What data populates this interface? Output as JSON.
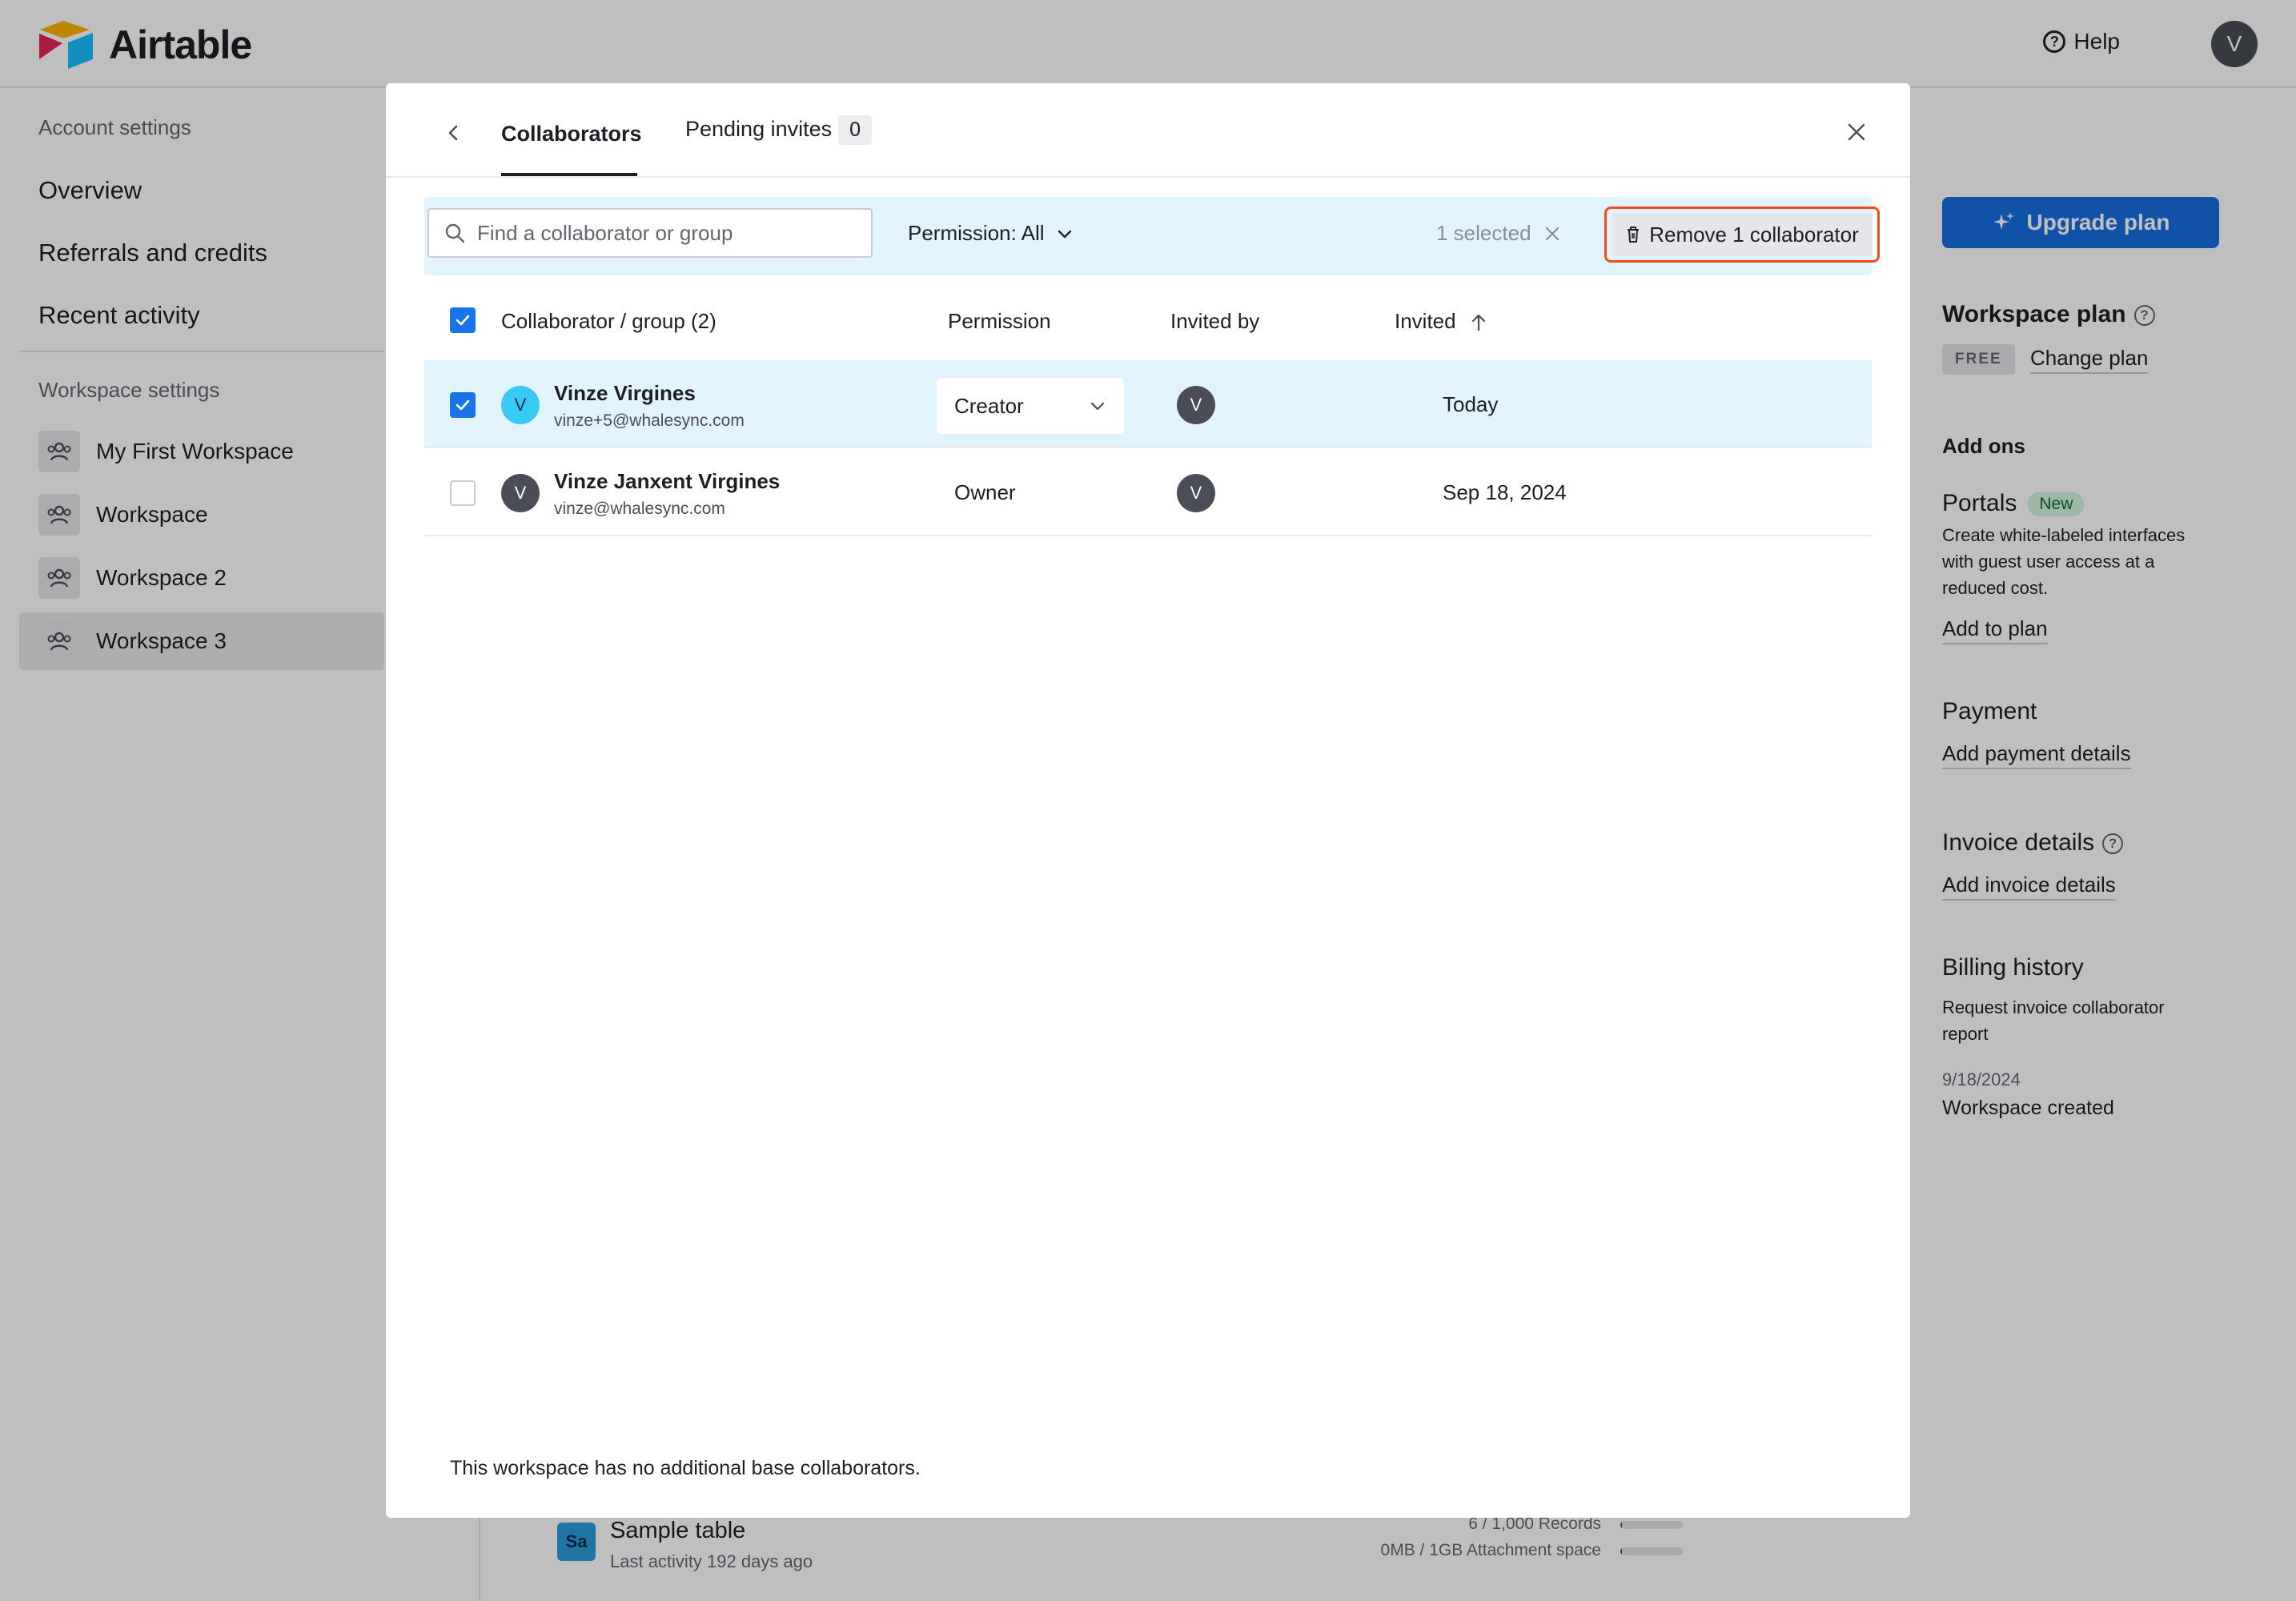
{
  "app": {
    "name": "Airtable",
    "help_label": "Help",
    "user_initial": "V"
  },
  "sidebar": {
    "account_heading": "Account settings",
    "account_items": [
      {
        "label": "Overview"
      },
      {
        "label": "Referrals and credits"
      },
      {
        "label": "Recent activity"
      }
    ],
    "workspace_heading": "Workspace settings",
    "workspaces": [
      {
        "label": "My First Workspace",
        "active": false
      },
      {
        "label": "Workspace",
        "active": false
      },
      {
        "label": "Workspace 2",
        "active": false
      },
      {
        "label": "Workspace 3",
        "active": true
      }
    ]
  },
  "right_panel": {
    "upgrade_label": "Upgrade plan",
    "plan_heading": "Workspace plan",
    "plan_badge": "FREE",
    "change_plan_label": "Change plan",
    "addons_heading": "Add ons",
    "portals_title": "Portals",
    "portals_badge": "New",
    "portals_desc_1": "Create white-labeled interfaces",
    "portals_desc_2": "with guest user access at a",
    "portals_desc_3": "reduced cost.",
    "add_to_plan_label": "Add to plan",
    "payment_heading": "Payment",
    "add_payment_label": "Add payment details",
    "invoice_heading": "Invoice details",
    "add_invoice_label": "Add invoice details",
    "billing_heading": "Billing history",
    "billing_request_1": "Request invoice collaborator",
    "billing_request_2": "report",
    "billing_date": "9/18/2024",
    "billing_event": "Workspace created"
  },
  "background_base": {
    "icon_label": "Sa",
    "title": "Sample table",
    "subtitle": "Last activity 192 days ago",
    "records_label": "6 / 1,000 Records",
    "records_fraction": 0.006,
    "attachments_label": "0MB / 1GB Attachment space",
    "attachments_fraction": 0.0
  },
  "modal": {
    "tabs": [
      {
        "label": "Collaborators",
        "active": true
      },
      {
        "label": "Pending invites",
        "count": "0",
        "active": false
      }
    ],
    "search_placeholder": "Find a collaborator or group",
    "permission_filter": "Permission: All",
    "selected_label": "1 selected",
    "remove_label": "Remove 1 collaborator",
    "columns": {
      "collaborator": "Collaborator / group (2)",
      "permission": "Permission",
      "invited_by": "Invited by",
      "invited": "Invited"
    },
    "rows": [
      {
        "initial": "V",
        "name": "Vinze Virgines",
        "email": "vinze+5@whalesync.com",
        "permission": "Creator",
        "invited_by_initial": "V",
        "invited": "Today",
        "selected": true
      },
      {
        "initial": "V",
        "name": "Vinze Janxent Virgines",
        "email": "vinze@whalesync.com",
        "permission": "Owner",
        "invited_by_initial": "V",
        "invited": "Sep 18, 2024",
        "selected": false
      }
    ],
    "footer_note": "This workspace has no additional base collaborators."
  },
  "colors": {
    "accent": "#166ee1",
    "selection_bg": "#e1f3fd",
    "highlight_outline": "#f04d1f",
    "checkbox_on": "#1a73e8"
  }
}
